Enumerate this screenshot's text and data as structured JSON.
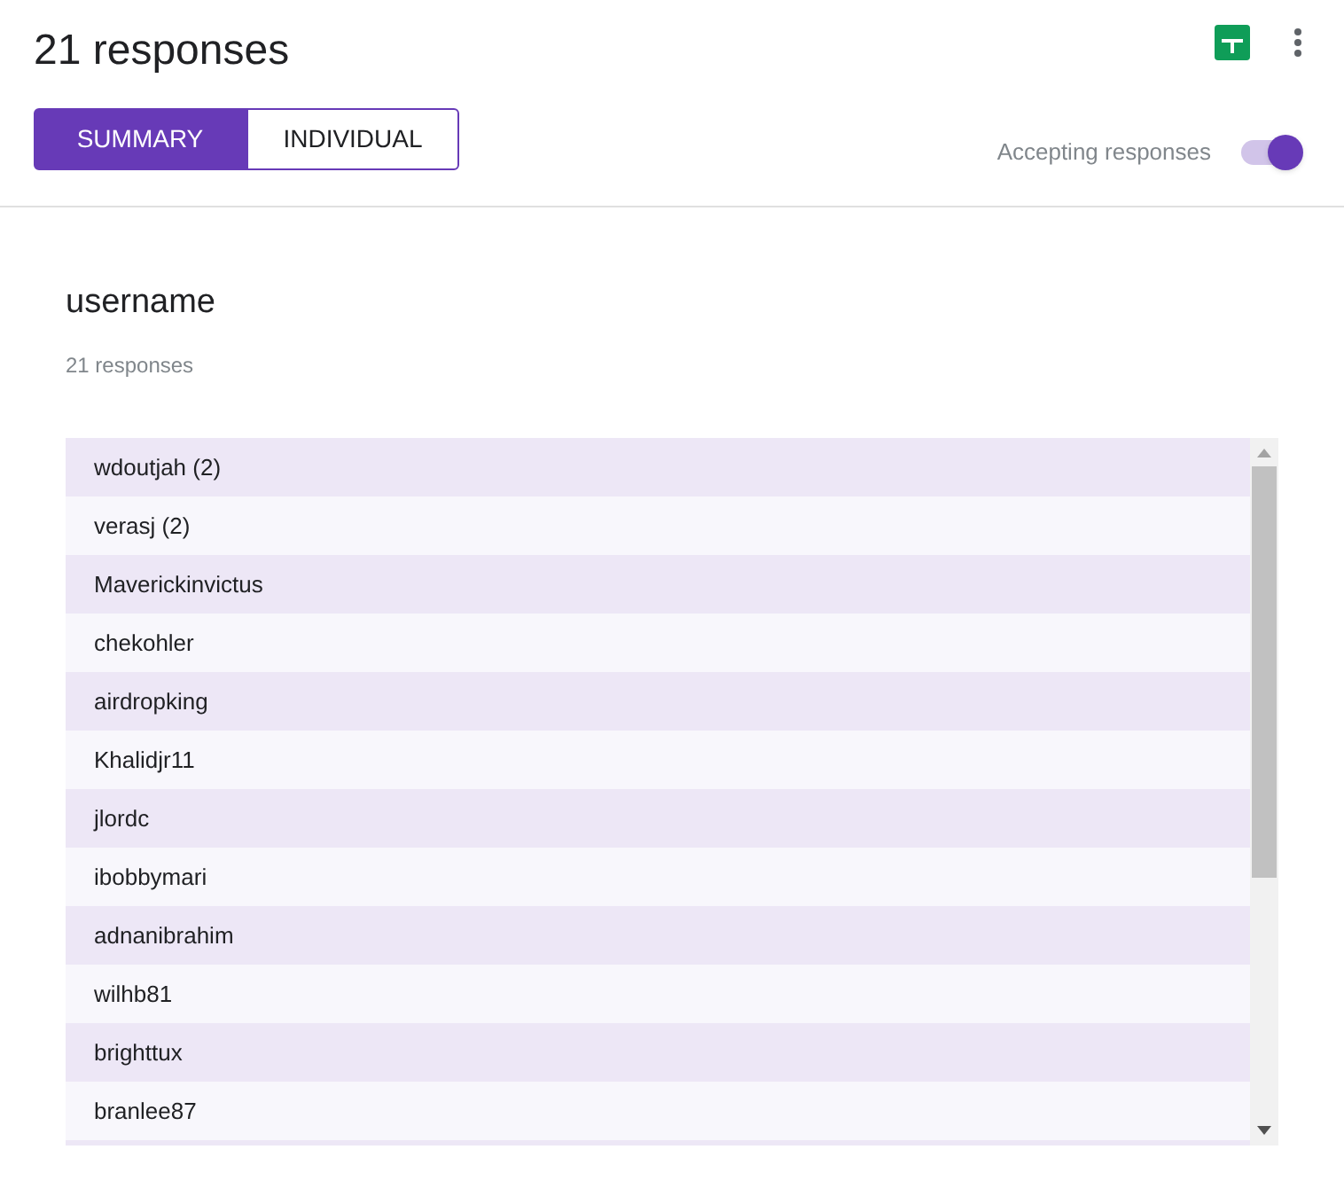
{
  "title": "21 responses",
  "tabs": [
    {
      "label": "SUMMARY",
      "selected": true
    },
    {
      "label": "INDIVIDUAL",
      "selected": false
    }
  ],
  "accepting": {
    "label": "Accepting responses",
    "on": true
  },
  "question": {
    "title": "username",
    "count": "21 responses",
    "answers": [
      "wdoutjah (2)",
      "verasj (2)",
      "Maverickinvictus",
      "chekohler",
      "airdropking",
      "Khalidjr11",
      "jlordc",
      "ibobbymari",
      "adnanibrahim",
      "wilhb81",
      "brighttux",
      "branlee87"
    ]
  }
}
